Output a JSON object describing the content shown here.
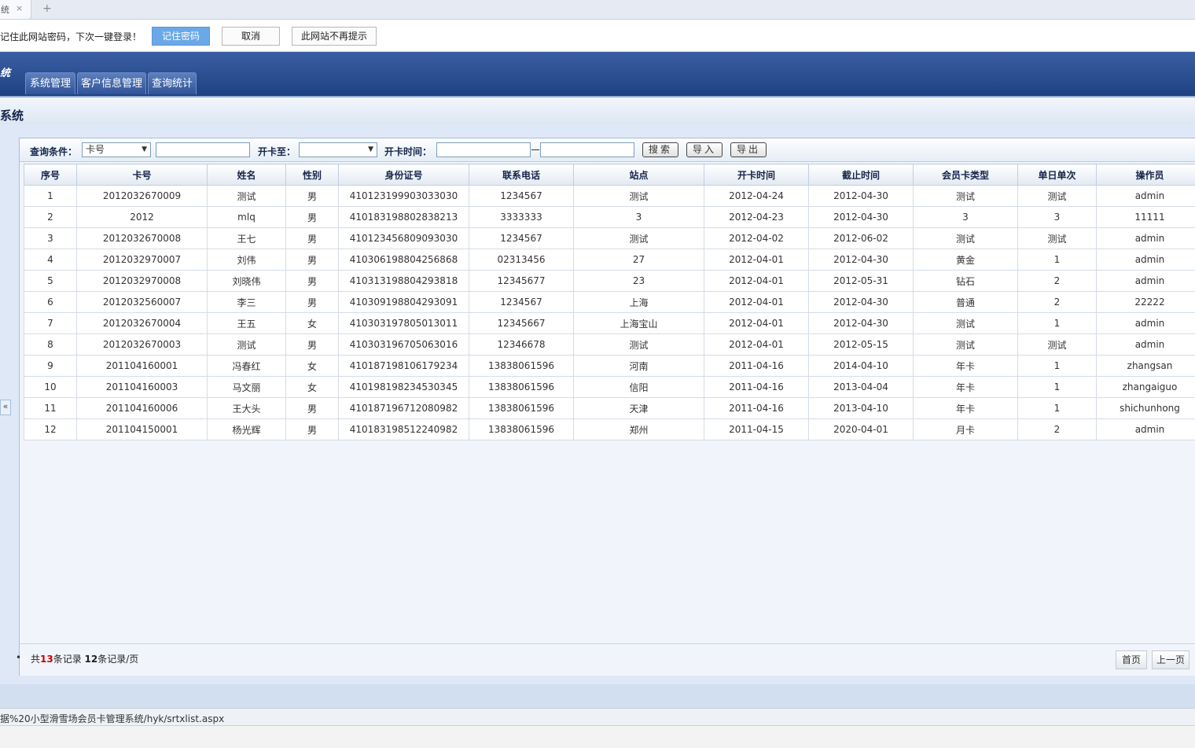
{
  "browser": {
    "tab_label": "统",
    "tab_close": "×",
    "new_tab": "+"
  },
  "password_bar": {
    "message": "记住此网站密码，下次一键登录！",
    "remember_label": "记住密码",
    "cancel_label": "取消",
    "never_label": "此网站不再提示"
  },
  "header": {
    "title": "统",
    "nav": [
      "系统管理",
      "客户信息管理",
      "查询统计"
    ]
  },
  "page_title": "系统",
  "search": {
    "condition_label": "查询条件：",
    "condition_value": "卡号",
    "open_to_label": "开卡至：",
    "open_to_value": "",
    "open_time_label": "开卡时间：",
    "search_btn": "搜索",
    "import_btn": "导入",
    "export_btn": "导出"
  },
  "table": {
    "headers": [
      "序号",
      "卡号",
      "姓名",
      "性别",
      "身份证号",
      "联系电话",
      "站点",
      "开卡时间",
      "截止时间",
      "会员卡类型",
      "单日单次",
      "操作员"
    ],
    "rows": [
      [
        "1",
        "2012032670009",
        "测试",
        "男",
        "410123199903033030",
        "1234567",
        "测试",
        "2012-04-24",
        "2012-04-30",
        "测试",
        "测试",
        "admin"
      ],
      [
        "2",
        "2012",
        "mlq",
        "男",
        "410183198802838213",
        "3333333",
        "3",
        "2012-04-23",
        "2012-04-30",
        "3",
        "3",
        "11111"
      ],
      [
        "3",
        "2012032670008",
        "王七",
        "男",
        "410123456809093030",
        "1234567",
        "测试",
        "2012-04-02",
        "2012-06-02",
        "测试",
        "测试",
        "admin"
      ],
      [
        "4",
        "2012032970007",
        "刘伟",
        "男",
        "410306198804256868",
        "02313456",
        "27",
        "2012-04-01",
        "2012-04-30",
        "黄金",
        "1",
        "admin"
      ],
      [
        "5",
        "2012032970008",
        "刘晓伟",
        "男",
        "410313198804293818",
        "12345677",
        "23",
        "2012-04-01",
        "2012-05-31",
        "钻石",
        "2",
        "admin"
      ],
      [
        "6",
        "2012032560007",
        "李三",
        "男",
        "410309198804293091",
        "1234567",
        "上海",
        "2012-04-01",
        "2012-04-30",
        "普通",
        "2",
        "22222"
      ],
      [
        "7",
        "2012032670004",
        "王五",
        "女",
        "410303197805013011",
        "12345667",
        "上海宝山",
        "2012-04-01",
        "2012-04-30",
        "测试",
        "1",
        "admin"
      ],
      [
        "8",
        "2012032670003",
        "测试",
        "男",
        "410303196705063016",
        "12346678",
        "测试",
        "2012-04-01",
        "2012-05-15",
        "测试",
        "测试",
        "admin"
      ],
      [
        "9",
        "201104160001",
        "冯春红",
        "女",
        "410187198106179234",
        "13838061596",
        "河南",
        "2011-04-16",
        "2014-04-10",
        "年卡",
        "1",
        "zhangsan"
      ],
      [
        "10",
        "201104160003",
        "马文丽",
        "女",
        "410198198234530345",
        "13838061596",
        "信阳",
        "2011-04-16",
        "2013-04-04",
        "年卡",
        "1",
        "zhangaiguo"
      ],
      [
        "11",
        "201104160006",
        "王大头",
        "男",
        "410187196712080982",
        "13838061596",
        "天津",
        "2011-04-16",
        "2013-04-10",
        "年卡",
        "1",
        "shichunhong"
      ],
      [
        "12",
        "201104150001",
        "杨光辉",
        "男",
        "410183198512240982",
        "13838061596",
        "郑州",
        "2011-04-15",
        "2020-04-01",
        "月卡",
        "2",
        "admin"
      ]
    ]
  },
  "footer": {
    "prefix": "共",
    "total": "13",
    "mid": "条记录 ",
    "per_page": "12",
    "suffix": "条记录/页",
    "first_page": "首页",
    "prev_page": "上一页",
    "collapse": "«"
  },
  "status_url": "据%20小型滑雪场会员卡管理系统/hyk/srtxlist.aspx"
}
